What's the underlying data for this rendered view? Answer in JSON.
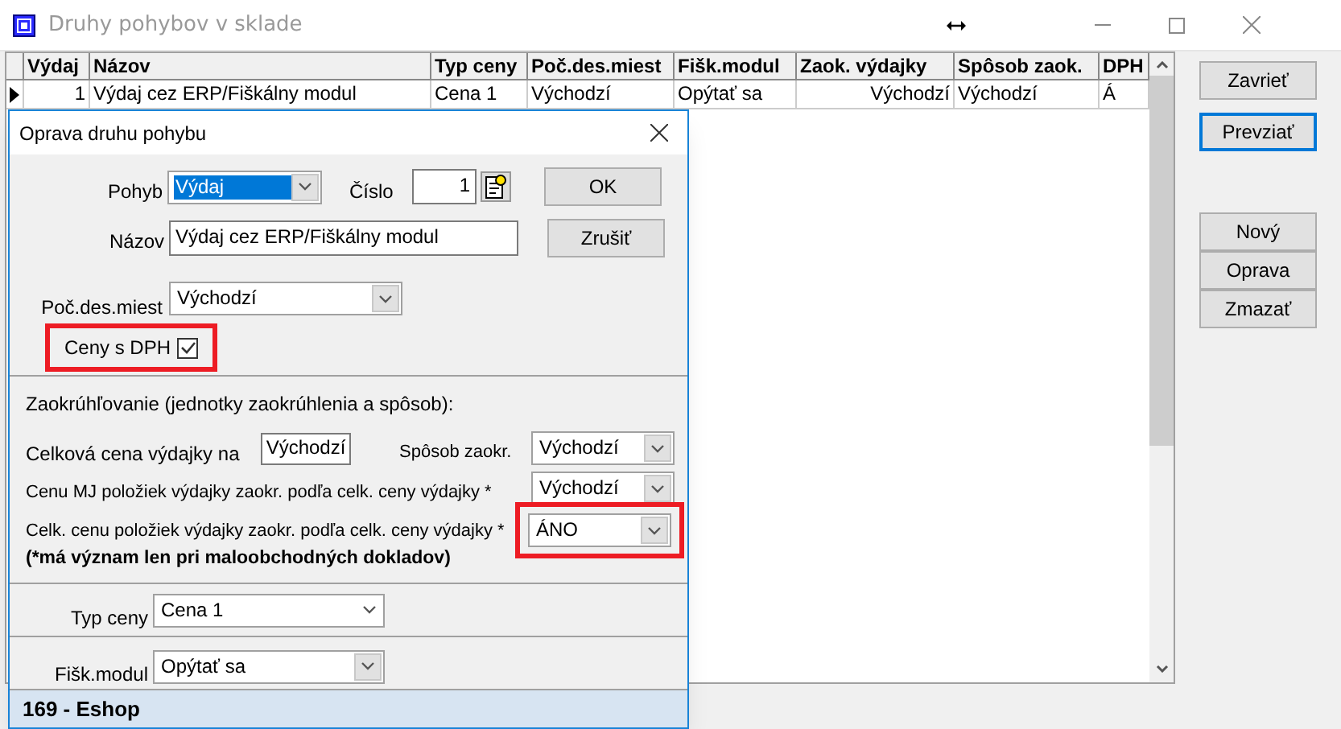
{
  "window": {
    "title": "Druhy pohybov v sklade"
  },
  "grid": {
    "columns": [
      "Výdaj",
      "Názov",
      "Typ ceny",
      "Poč.des.miest",
      "Fišk.modul",
      "Zaok. výdajky",
      "Spôsob zaok.",
      "DPH"
    ],
    "rows": [
      {
        "selected": true,
        "cells": [
          "1",
          "Výdaj cez ERP/Fiškálny modul",
          "Cena 1",
          "Východzí",
          "Opýtať sa",
          "Východzí",
          "Východzí",
          "Á"
        ]
      }
    ]
  },
  "side_buttons": [
    {
      "label": "Zavrieť",
      "focused": false
    },
    {
      "label": "Prevziať",
      "focused": true
    },
    {
      "label": "Nový",
      "focused": false
    },
    {
      "label": "Oprava",
      "focused": false
    },
    {
      "label": "Zmazať",
      "focused": false
    }
  ],
  "dialog": {
    "title": "Oprava druhu pohybu",
    "movement": {
      "label": "Pohyb",
      "value": "Výdaj",
      "text_selected": true
    },
    "number": {
      "label": "Číslo",
      "value": "1"
    },
    "ok": "OK",
    "cancel": "Zrušiť",
    "name": {
      "label": "Názov",
      "value": "Výdaj cez ERP/Fiškálny modul"
    },
    "decimals": {
      "label": "Poč.des.miest",
      "value": "Východzí"
    },
    "vat": {
      "label": "Ceny s DPH",
      "checked": true,
      "highlighted": true
    },
    "rounding": {
      "heading": "Zaokrúhľovanie (jednotky zaokrúhlenia a spôsob):",
      "total_label": "Celková cena výdajky na",
      "total_value": "Východzí",
      "method_label": "Spôsob zaokr.",
      "method_value": "Východzí",
      "unit_label": "Cenu MJ položiek výdajky zaokr. podľa  celk. ceny výdajky *",
      "unit_value": "Východzí",
      "items_label": "Celk. cenu položiek výdajky zaokr. podľa  celk. ceny výdajky *",
      "items_value": "ÁNO",
      "items_highlighted": true,
      "note": "(*má význam len pri maloobchodných dokladov)"
    },
    "price_type": {
      "label": "Typ ceny",
      "value": "Cena 1"
    },
    "fiscal": {
      "label": "Fišk.modul",
      "value": "Opýtať sa"
    },
    "footer": "169 - Eshop"
  }
}
